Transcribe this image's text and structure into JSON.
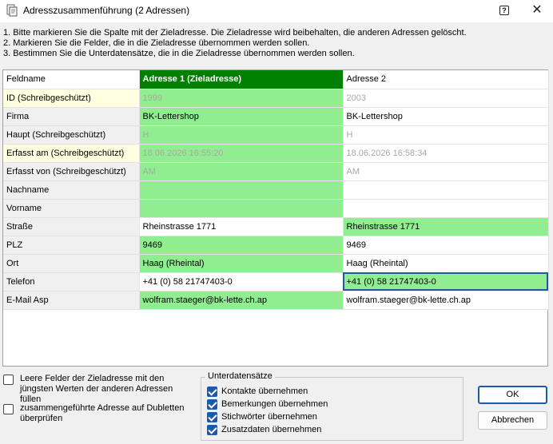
{
  "window": {
    "title": "Adresszusammenführung (2 Adressen)",
    "help_label": "?",
    "close_label": "✕"
  },
  "instructions": [
    "1. Bitte markieren Sie die Spalte mit der Zieladresse. Die Zieladresse wird beibehalten, die anderen Adressen gelöscht.",
    "2. Markieren Sie die Felder, die in die Zieladresse übernommen werden sollen.",
    "3. Bestimmen Sie die Unterdatensätze, die in die Zieladresse übernommen werden sollen."
  ],
  "grid": {
    "headers": {
      "field": "Feldname",
      "address1": "Adresse 1 (Zieladresse)",
      "address2": "Adresse 2"
    },
    "rows": [
      {
        "field": "ID (Schreibgeschützt)",
        "a1": "1999",
        "a2": "2003"
      },
      {
        "field": "Firma",
        "a1": "BK-Lettershop",
        "a2": "BK-Lettershop"
      },
      {
        "field": "Haupt (Schreibgeschützt)",
        "a1": "H",
        "a2": "H"
      },
      {
        "field": "Erfasst am (Schreibgeschützt)",
        "a1": "18.06.2026 16:55:20",
        "a2": "18.06.2026 16:58:34"
      },
      {
        "field": "Erfasst von (Schreibgeschützt)",
        "a1": "AM",
        "a2": "AM"
      },
      {
        "field": "Nachname",
        "a1": "",
        "a2": ""
      },
      {
        "field": "Vorname",
        "a1": "",
        "a2": ""
      },
      {
        "field": "Straße",
        "a1": "Rheinstrasse 1771",
        "a2": "Rheinstrasse 1771"
      },
      {
        "field": "PLZ",
        "a1": "9469",
        "a2": "9469"
      },
      {
        "field": "Ort",
        "a1": "Haag (Rheintal)",
        "a2": "Haag (Rheintal)"
      },
      {
        "field": "Telefon",
        "a1": "+41 (0) 58 21747403-0",
        "a2": "+41 (0) 58 21747403-0"
      },
      {
        "field": "E-Mail Asp",
        "a1": "wolfram.staeger@bk-lette.ch.ap",
        "a2": "wolfram.staeger@bk-lette.ch.ap"
      }
    ]
  },
  "options": {
    "fill_empty": {
      "label": "Leere Felder der Zieladresse mit den jüngsten Werten der anderen Adressen füllen",
      "checked": false
    },
    "check_duplicates": {
      "label": "zusammengeführte Adresse auf Dubletten überprüfen",
      "checked": false
    }
  },
  "subrecords": {
    "title": "Unterdatensätze",
    "items": [
      {
        "label": "Kontakte übernehmen",
        "checked": true
      },
      {
        "label": "Bemerkungen übernehmen",
        "checked": true
      },
      {
        "label": "Stichwörter übernehmen",
        "checked": true
      },
      {
        "label": "Zusatzdaten übernehmen",
        "checked": true
      }
    ]
  },
  "buttons": {
    "ok": "OK",
    "cancel": "Abbrechen"
  },
  "colors": {
    "selected_column_header": "#008000",
    "selected_cell": "#90ee90",
    "readonly_field": "#ffffe1",
    "accent": "#1e5aa8"
  }
}
